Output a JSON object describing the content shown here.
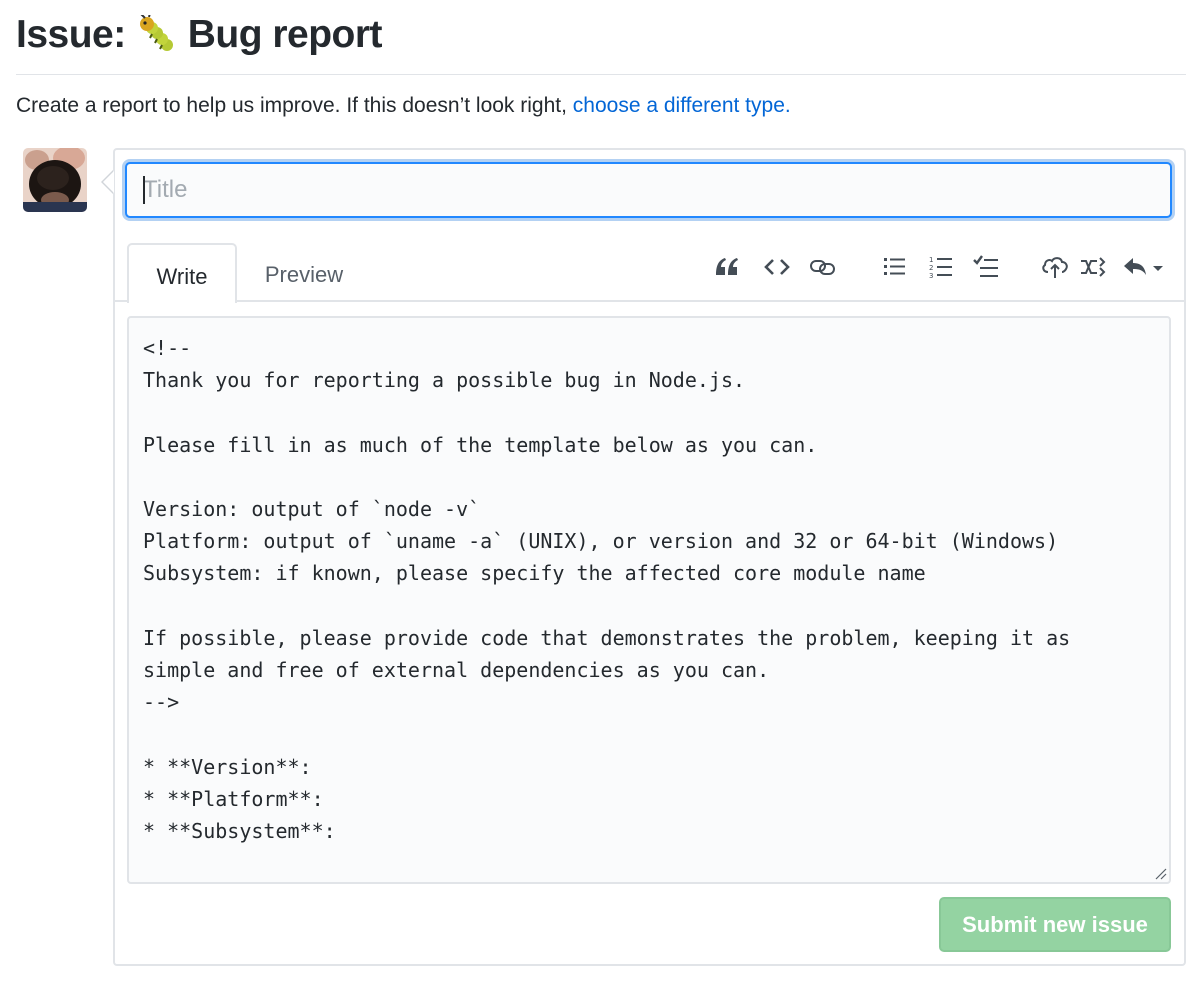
{
  "header": {
    "title_prefix": "Issue:",
    "title_text": "Bug report"
  },
  "intro": {
    "text": "Create a report to help us improve. If this doesn’t look right, ",
    "link_text": "choose a different type."
  },
  "form": {
    "title_placeholder": "Title",
    "title_value": "",
    "tabs": [
      {
        "label": "Write",
        "selected": true
      },
      {
        "label": "Preview",
        "selected": false
      }
    ],
    "toolbar": [
      "quote-icon",
      "code-icon",
      "link-icon",
      "unordered-list-icon",
      "ordered-list-icon",
      "task-list-icon",
      "upload-icon",
      "cross-reference-icon",
      "reply-icon"
    ],
    "body": "<!--\nThank you for reporting a possible bug in Node.js.\n\nPlease fill in as much of the template below as you can.\n\nVersion: output of `node -v`\nPlatform: output of `uname -a` (UNIX), or version and 32 or 64-bit (Windows)\nSubsystem: if known, please specify the affected core module name\n\nIf possible, please provide code that demonstrates the problem, keeping it as\nsimple and free of external dependencies as you can.\n-->\n\n* **Version**:\n* **Platform**:\n* **Subsystem**:",
    "submit_label": "Submit new issue"
  },
  "colors": {
    "link": "#0366d6",
    "focus_border": "#2188ff",
    "submit_disabled": "#94d3a2",
    "text": "#24292e"
  }
}
